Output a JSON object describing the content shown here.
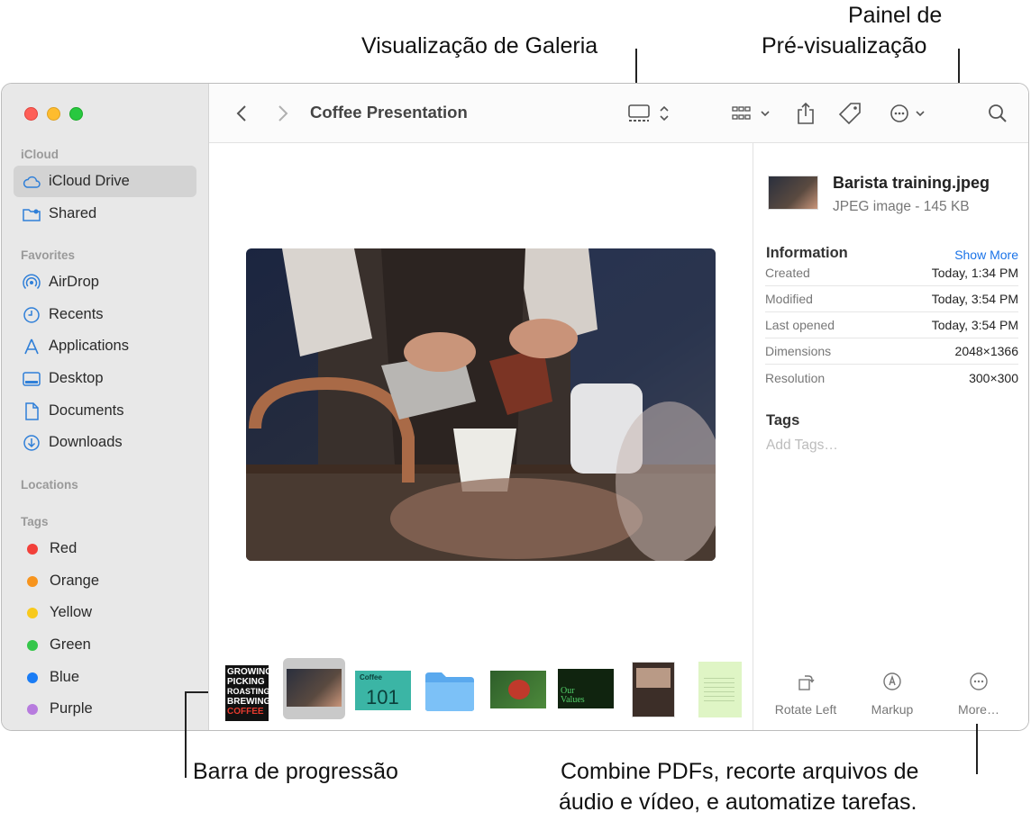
{
  "callouts": {
    "gallery_view": "Visualização de Galeria",
    "preview_pane_line1": "Painel de",
    "preview_pane_line2": "Pré-visualização",
    "scrubber_bar": "Barra de progressão",
    "more_line1": "Combine PDFs, recorte arquivos de",
    "more_line2": "áudio e vídeo, e automatize tarefas."
  },
  "sidebar": {
    "sections": {
      "icloud": "iCloud",
      "favorites": "Favorites",
      "locations": "Locations",
      "tags": "Tags"
    },
    "icloud_items": [
      "iCloud Drive",
      "Shared"
    ],
    "favorites_items": [
      "AirDrop",
      "Recents",
      "Applications",
      "Desktop",
      "Documents",
      "Downloads"
    ],
    "tag_items": [
      "Red",
      "Orange",
      "Yellow",
      "Green",
      "Blue",
      "Purple"
    ],
    "tag_colors": [
      "#f2403a",
      "#f7941d",
      "#f8c91c",
      "#35c64a",
      "#1a7cf5",
      "#b77bde"
    ]
  },
  "toolbar": {
    "title": "Coffee Presentation"
  },
  "gallery": {
    "thumb1_text": [
      "GROWING",
      "PICKING",
      "ROASTING",
      "BREWING",
      "COFFEE"
    ],
    "thumb3_top": "Coffee",
    "thumb3_number": "101",
    "thumb6_text": [
      "Our",
      "Values"
    ]
  },
  "preview": {
    "file_name": "Barista training.jpeg",
    "file_kind": "JPEG image - 145 KB",
    "information_heading": "Information",
    "show_more": "Show More",
    "info": [
      {
        "key": "Created",
        "value": "Today, 1:34 PM"
      },
      {
        "key": "Modified",
        "value": "Today, 3:54 PM"
      },
      {
        "key": "Last opened",
        "value": "Today, 3:54 PM"
      },
      {
        "key": "Dimensions",
        "value": "2048×1366"
      },
      {
        "key": "Resolution",
        "value": "300×300"
      }
    ],
    "tags_heading": "Tags",
    "tags_placeholder": "Add Tags…",
    "actions": [
      "Rotate Left",
      "Markup",
      "More…"
    ]
  }
}
